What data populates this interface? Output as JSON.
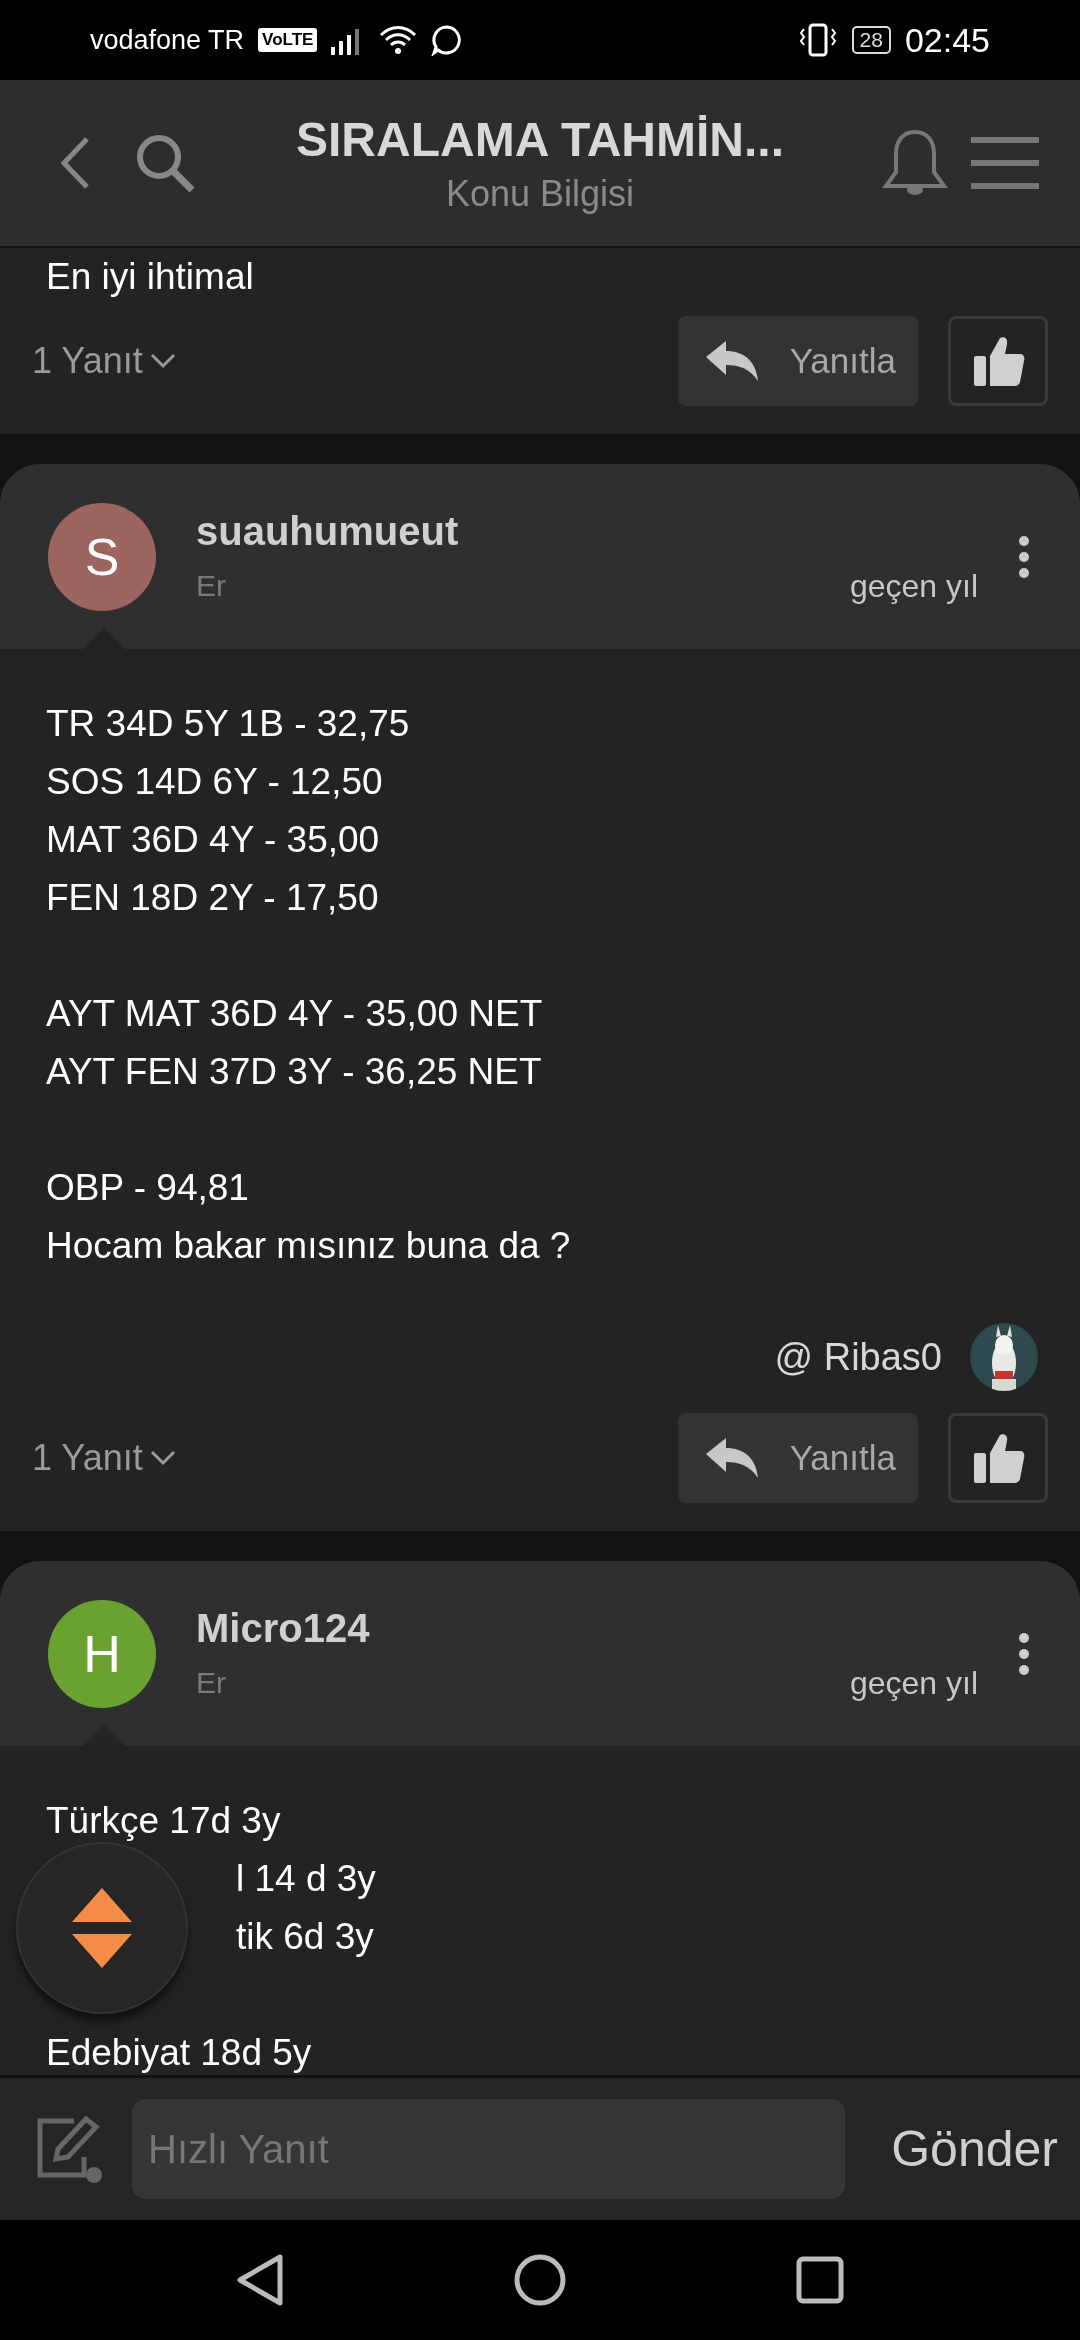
{
  "status_bar": {
    "carrier": "vodafone TR",
    "volte": "VoLTE",
    "battery": "28",
    "time": "02:45"
  },
  "header": {
    "title": "SIRALAMA TAHMİN...",
    "subtitle": "Konu Bilgisi"
  },
  "posts": [
    {
      "kind": "fragment",
      "lines": [
        [
          {
            "text": "En iyi ihtimal",
            "kind": "plain"
          }
        ]
      ],
      "replies": "1 Yanıt",
      "reply_label": "Yanıtla",
      "liked": false
    },
    {
      "kind": "full",
      "initial": "S",
      "color": "#9c6560",
      "username": "suauhumueut",
      "gender": "Er",
      "time": "geçen yıl",
      "lines": [
        [
          {
            "text": "TR 34D 5Y 1B - 32,75",
            "kind": "plain"
          },
          {
            "text": "SOS 14D 6Y - 12,50",
            "kind": "plain"
          },
          {
            "text": "MAT 36D 4Y - 35,00",
            "kind": "plain"
          },
          {
            "text": "FEN 18D 2Y - 17,50",
            "kind": "plain"
          }
        ],
        [
          {
            "text": "AYT MAT 36D 4Y - 35,00 NET",
            "kind": "plain"
          },
          {
            "text": "AYT FEN 37D 3Y - 36,25 NET",
            "kind": "plain"
          }
        ],
        [
          {
            "text": "OBP - 94,81",
            "kind": "plain"
          },
          {
            "text": "Hocam bakar mısınız buna da ?",
            "kind": "plain"
          }
        ]
      ],
      "mention": "@ Ribas0",
      "replies": "1 Yanıt",
      "reply_label": "Yanıtla",
      "liked": false
    },
    {
      "kind": "full",
      "initial": "H",
      "color": "#6aa232",
      "username": "Micro124",
      "gender": "Er",
      "time": "geçen yıl",
      "lines": [
        [
          {
            "text": "Türkçe 17d 3y",
            "kind": "plain"
          },
          {
            "text": "l 14 d 3y",
            "kind": "covered"
          },
          {
            "text": "tik 6d 3y",
            "kind": "covered"
          },
          {
            "kind": "hidden"
          },
          {
            "text": "Edebiyat 18d 5y",
            "kind": "plain"
          }
        ]
      ]
    }
  ],
  "reply_bar": {
    "placeholder": "Hızlı Yanıt",
    "send": "Gönder"
  }
}
